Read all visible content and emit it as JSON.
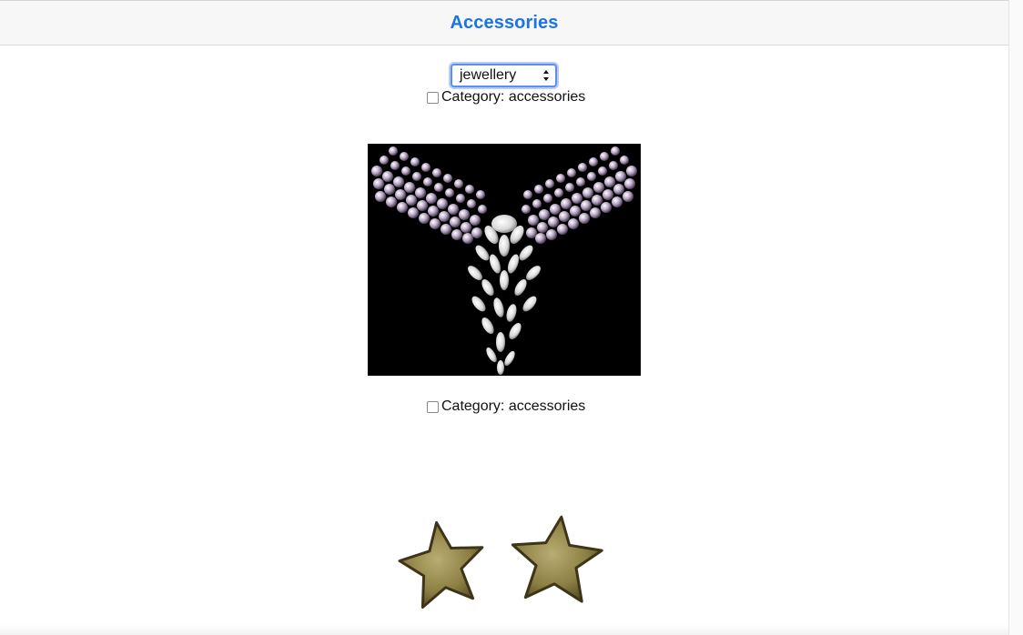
{
  "header": {
    "title": "Accessories"
  },
  "filter": {
    "selected": "jewellery"
  },
  "products": [
    {
      "category_label": "Category: accessories",
      "image": "pearl-diamond-necklace"
    },
    {
      "category_label": "Category: accessories",
      "image": "gold-star-earrings"
    }
  ],
  "colors": {
    "accent": "#1a73e8",
    "header_bg": "#f7f7f7",
    "focus_ring": "#5b8ff0"
  }
}
